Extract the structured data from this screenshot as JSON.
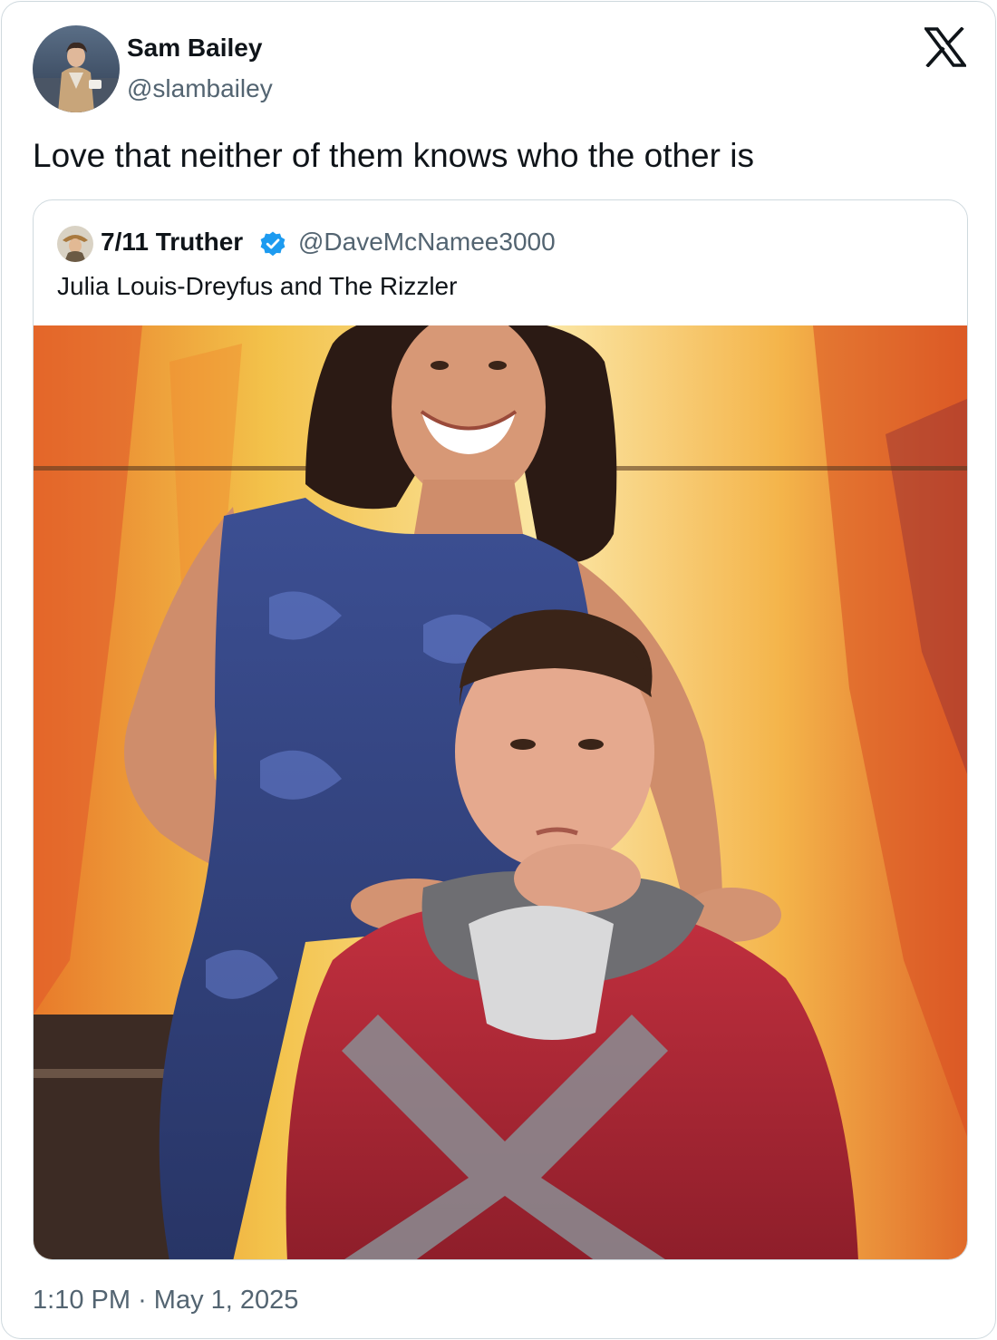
{
  "tweet": {
    "author": {
      "name": "Sam Bailey",
      "handle": "@slambailey"
    },
    "text": "Love that neither of them knows who the other is",
    "time": "1:10 PM",
    "separator": "·",
    "date": "May 1, 2025"
  },
  "quoted_tweet": {
    "author": {
      "name": "7/11 Truther",
      "handle": "@DaveMcNamee3000",
      "verified": true
    },
    "text": "Julia Louis-Dreyfus and The Rizzler"
  },
  "icons": {
    "brand": "x-logo-icon",
    "verified": "verified-badge-icon"
  },
  "colors": {
    "text_primary": "#0f1419",
    "text_secondary": "#536471",
    "border": "#cfd9de",
    "verified_blue": "#1d9bf0"
  }
}
